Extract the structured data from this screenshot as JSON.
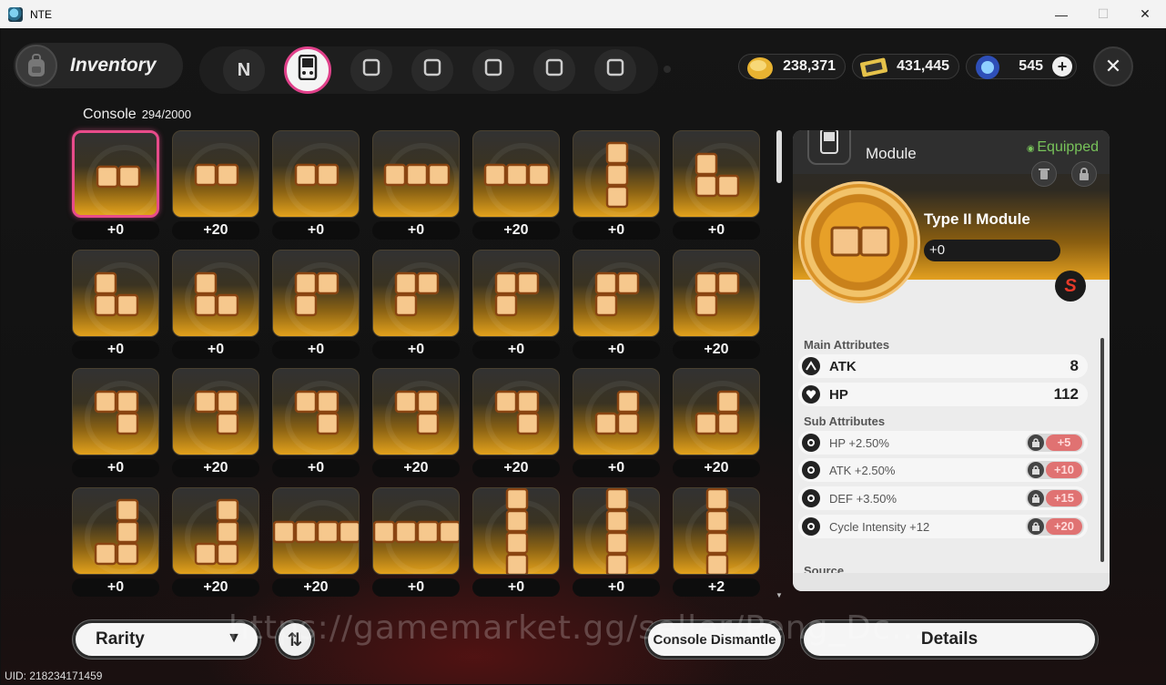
{
  "window": {
    "title": "NTE",
    "minimize": "—",
    "maximize": "☐",
    "close": "✕"
  },
  "header": {
    "title": "Inventory"
  },
  "categories": [
    {
      "icon": "n-logo-icon",
      "glyph": "N"
    },
    {
      "icon": "console-icon",
      "glyph": "",
      "active": true
    },
    {
      "icon": "card-icon",
      "glyph": ""
    },
    {
      "icon": "box-icon",
      "glyph": ""
    },
    {
      "icon": "fork-knife-icon",
      "glyph": ""
    },
    {
      "icon": "cube-icon",
      "glyph": ""
    },
    {
      "icon": "home-icon",
      "glyph": ""
    }
  ],
  "currencies": [
    {
      "icon": "gold-coin-icon",
      "value": "238,371"
    },
    {
      "icon": "ticket-icon",
      "value": "431,445"
    },
    {
      "icon": "crystal-icon",
      "value": "545",
      "add": "+"
    }
  ],
  "close_label": "✕",
  "console": {
    "label": "Console",
    "count": "294/2000"
  },
  "items": [
    {
      "shape": "h2",
      "level": "+0",
      "selected": true
    },
    {
      "shape": "h2",
      "level": "+20"
    },
    {
      "shape": "h2",
      "level": "+0"
    },
    {
      "shape": "h3",
      "level": "+0"
    },
    {
      "shape": "h3",
      "level": "+20"
    },
    {
      "shape": "v3",
      "level": "+0"
    },
    {
      "shape": "L",
      "level": "+0"
    },
    {
      "shape": "L",
      "level": "+0"
    },
    {
      "shape": "L",
      "level": "+0"
    },
    {
      "shape": "Ltop",
      "level": "+0"
    },
    {
      "shape": "Ltop",
      "level": "+0"
    },
    {
      "shape": "Ltop",
      "level": "+0"
    },
    {
      "shape": "Ltop",
      "level": "+0"
    },
    {
      "shape": "Ltop",
      "level": "+20"
    },
    {
      "shape": "J",
      "level": "+0"
    },
    {
      "shape": "J",
      "level": "+20"
    },
    {
      "shape": "J",
      "level": "+0"
    },
    {
      "shape": "J",
      "level": "+20"
    },
    {
      "shape": "J",
      "level": "+20"
    },
    {
      "shape": "Jb",
      "level": "+0"
    },
    {
      "shape": "Jb",
      "level": "+20"
    },
    {
      "shape": "Jv",
      "level": "+0"
    },
    {
      "shape": "Jv",
      "level": "+20"
    },
    {
      "shape": "h4",
      "level": "+20"
    },
    {
      "shape": "h4",
      "level": "+0"
    },
    {
      "shape": "v4",
      "level": "+0"
    },
    {
      "shape": "v4",
      "level": "+0"
    },
    {
      "shape": "v4",
      "level": "+2"
    }
  ],
  "detail": {
    "category": "Module",
    "status": "Equipped",
    "name": "Type II Module",
    "level": "+0",
    "main_title": "Main Attributes",
    "main": [
      {
        "icon": "atk-icon",
        "name": "ATK",
        "value": "8"
      },
      {
        "icon": "hp-icon",
        "name": "HP",
        "value": "112"
      }
    ],
    "sub_title": "Sub Attributes",
    "sub": [
      {
        "icon": "hp-icon",
        "name": "HP +2.50%",
        "roll": "+5"
      },
      {
        "icon": "atk-icon",
        "name": "ATK +2.50%",
        "roll": "+10"
      },
      {
        "icon": "def-icon",
        "name": "DEF +3.50%",
        "roll": "+15"
      },
      {
        "icon": "cycle-icon",
        "name": "Cycle Intensity +12",
        "roll": "+20"
      }
    ],
    "source_title": "Source",
    "set_glyph": "S"
  },
  "bottom": {
    "rarity": "Rarity",
    "sort_glyph": "⇅",
    "dismantle": "Console Dismantle",
    "details": "Details"
  },
  "watermark": "https://gamemarket.gg/seller/Peng_Dc...",
  "uid": "UID: 218234171459",
  "colors": {
    "accent_pink": "#e84b8a",
    "gold": "#e3a21c",
    "equipped_green": "#78c35a",
    "roll_red": "#e07272"
  }
}
